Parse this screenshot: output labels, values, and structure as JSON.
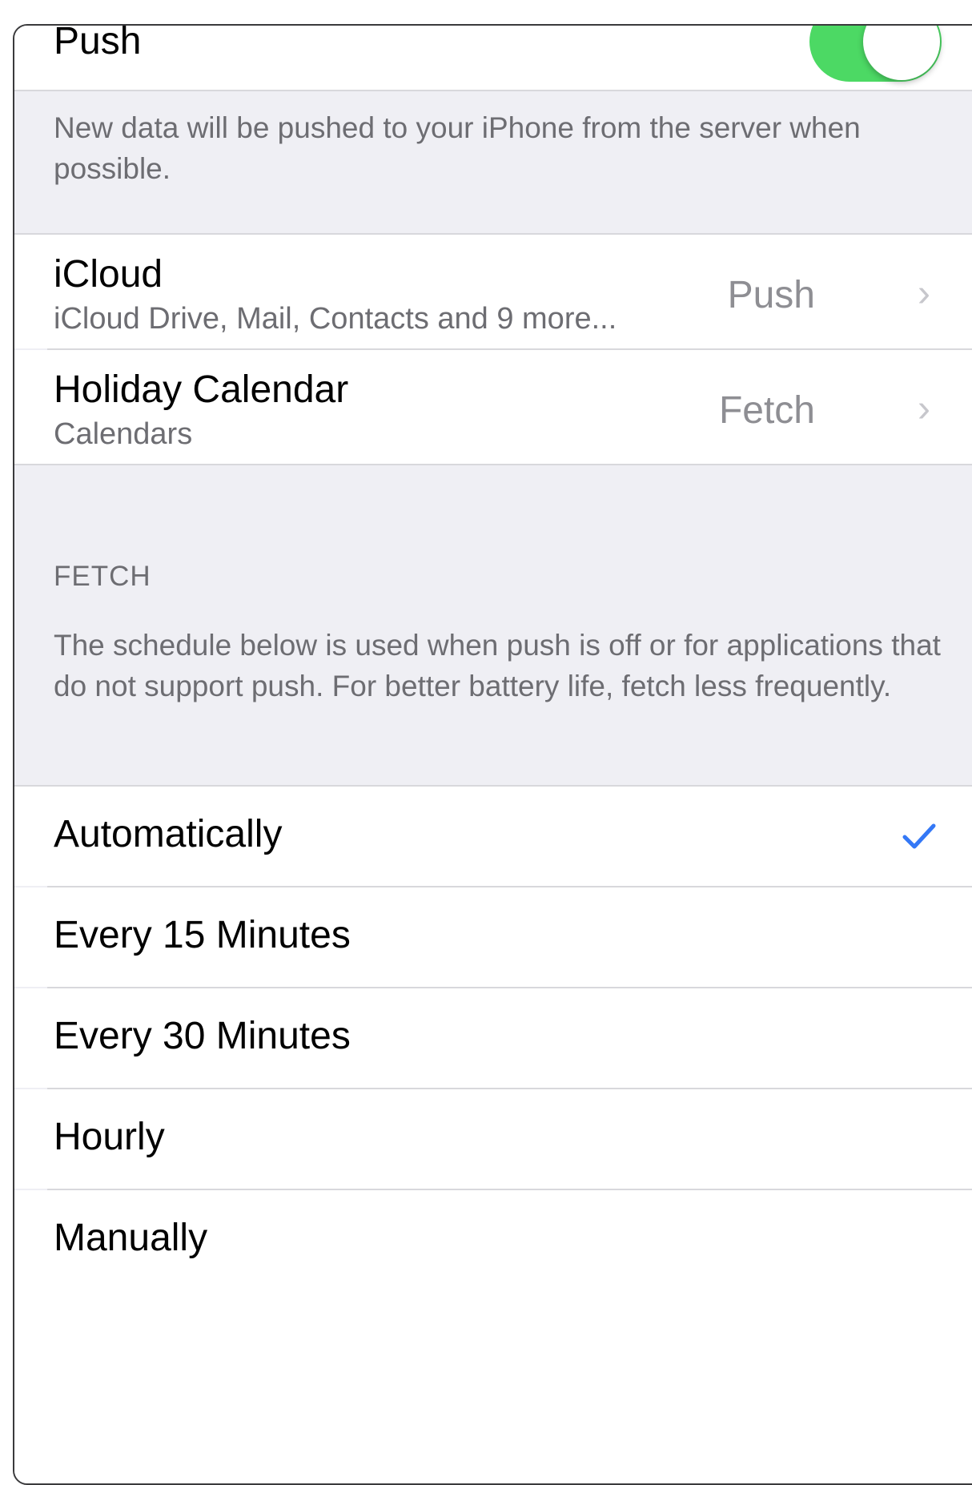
{
  "push_row": {
    "label": "Push",
    "toggle_on": true
  },
  "push_footer": "New data will be pushed to your iPhone from the server when possible.",
  "accounts": [
    {
      "title": "iCloud",
      "subtitle": "iCloud Drive, Mail, Contacts and 9 more...",
      "detail": "Push"
    },
    {
      "title": "Holiday Calendar",
      "subtitle": "Calendars",
      "detail": "Fetch"
    }
  ],
  "fetch_header": "FETCH",
  "fetch_description": "The schedule below is used when push is off or for applications that do not support push. For better battery life, fetch less frequently.",
  "schedule": [
    {
      "label": "Automatically",
      "selected": true
    },
    {
      "label": "Every 15 Minutes",
      "selected": false
    },
    {
      "label": "Every 30 Minutes",
      "selected": false
    },
    {
      "label": "Hourly",
      "selected": false
    },
    {
      "label": "Manually",
      "selected": false
    }
  ],
  "colors": {
    "toggle_on": "#4cd964",
    "checkmark": "#3478f6",
    "group_background": "#efeff4",
    "secondary_text": "#8e8e93"
  },
  "icons": {
    "chevron": "chevron-right-icon",
    "check": "checkmark-icon"
  }
}
